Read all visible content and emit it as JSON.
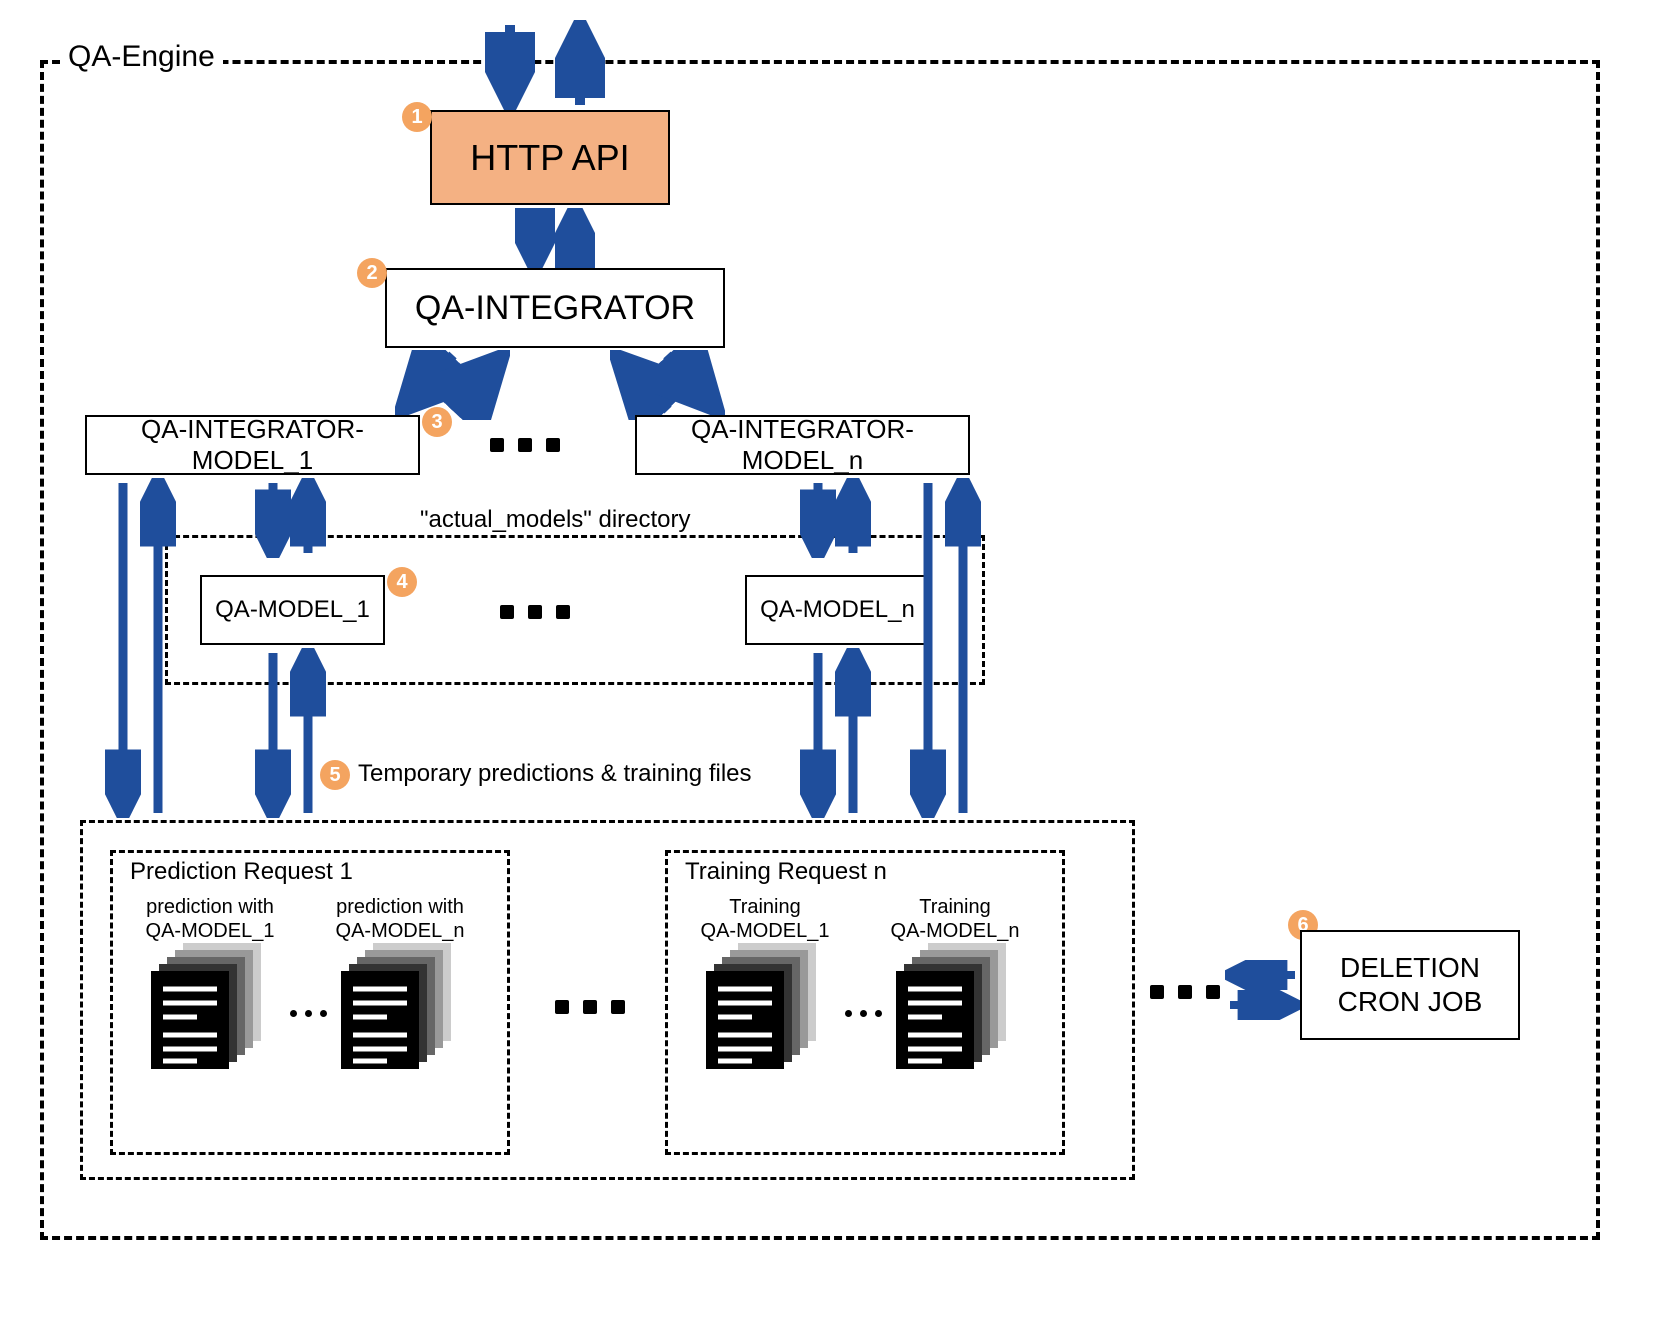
{
  "engine_title": "QA-Engine",
  "http_api": "HTTP API",
  "qa_integrator": "QA-INTEGRATOR",
  "qa_integrator_model_1": "QA-INTEGRATOR-MODEL_1",
  "qa_integrator_model_n": "QA-INTEGRATOR-MODEL_n",
  "actual_models_label": "\"actual_models\" directory",
  "qa_model_1": "QA-MODEL_1",
  "qa_model_n": "QA-MODEL_n",
  "temp_files_label": "Temporary predictions & training files",
  "prediction_request_1": "Prediction Request 1",
  "training_request_n": "Training Request n",
  "pred_label_1_a": "prediction with",
  "pred_label_1_b": "QA-MODEL_1",
  "pred_label_n_a": "prediction with",
  "pred_label_n_b": "QA-MODEL_n",
  "train_label_1_a": "Training",
  "train_label_1_b": "QA-MODEL_1",
  "train_label_n_a": "Training",
  "train_label_n_b": "QA-MODEL_n",
  "deletion_cron": "DELETION CRON JOB",
  "badges": {
    "b1": "1",
    "b2": "2",
    "b3": "3",
    "b4": "4",
    "b5": "5",
    "b6": "6"
  },
  "colors": {
    "arrow_blue": "#1f4e9c",
    "badge_orange": "#f4a460",
    "http_fill": "#f4b183"
  }
}
